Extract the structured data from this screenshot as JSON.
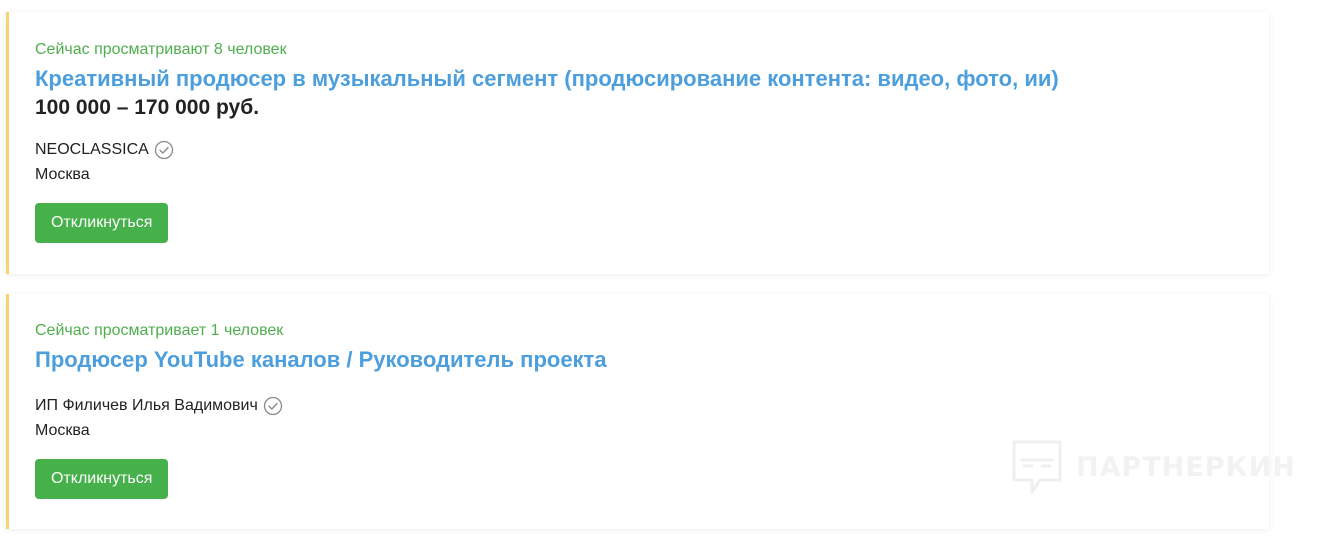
{
  "vacancies": [
    {
      "viewers": "Сейчас просматривают 8 человек",
      "title": "Креативный продюсер в музыкальный сегмент (продюсирование контента: видео, фото, ии)",
      "salary": "100 000 – 170 000 руб.",
      "company": "NEOCLASSICA",
      "city": "Москва",
      "apply_label": "Откликнуться"
    },
    {
      "viewers": "Сейчас просматривает 1 человек",
      "title": "Продюсер YouTube каналов / Руководитель проекта",
      "company": "ИП Филичев Илья Вадимович",
      "city": "Москва",
      "apply_label": "Откликнуться"
    }
  ],
  "watermark": {
    "text": "ПАРТНЕРКИН"
  },
  "colors": {
    "accent_border": "#f5d376",
    "viewers_text": "#4fae4e",
    "title_link": "#4d9edc",
    "button_bg": "#46b04a"
  },
  "icons": {
    "verified": "check-circle-icon",
    "watermark_logo": "chat-bubble-logo-icon"
  }
}
